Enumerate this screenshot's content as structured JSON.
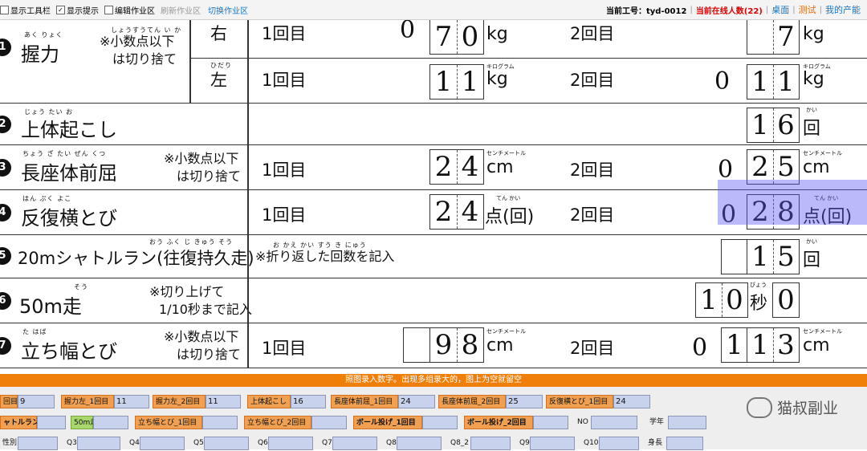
{
  "toolbar": {
    "cb_toolbar": "显示工具栏",
    "cb_hint": "显示提示",
    "cb_edit": "编辑作业区",
    "refresh": "刷新作业区",
    "switch": "切换作业区",
    "worker_label": "当前工号：tyd-0012",
    "online": "当前在线人数(22)",
    "desk": "桌面",
    "test": "测试",
    "yield": "我的产能"
  },
  "form": {
    "r1": {
      "num": "1",
      "title": "握力",
      "ruby": "あく りょく",
      "note1": "※小数点以下",
      "note2": "は切り捨て",
      "note_ruby": "しょうすうてん い か",
      "right": {
        "label": "右",
        "count1": "1回目",
        "d1a": "7",
        "d1b": "0",
        "unit": "kg",
        "count2": "2回目",
        "d2b": "7",
        "pre": "0"
      },
      "left": {
        "label": "左",
        "ruby": "ひだり",
        "count1": "1回目",
        "d1a": "1",
        "d1b": "1",
        "unit": "kg",
        "unit_ruby": "キログラム",
        "count2": "2回目",
        "pre": "0",
        "d2a": "1",
        "d2b": "1"
      }
    },
    "r2": {
      "num": "2",
      "title": "上体起こし",
      "ruby": "じょう たい お",
      "v1": "1",
      "v2": "6",
      "unit": "回",
      "unit_ruby": "かい"
    },
    "r3": {
      "num": "3",
      "title": "長座体前屈",
      "ruby": "ちょう ざ たい ぜん くつ",
      "note1": "※小数点以下",
      "note2": "は切り捨て",
      "count1": "1回目",
      "d1a": "2",
      "d1b": "4",
      "unit": "cm",
      "unit_ruby": "センチメートル",
      "count2": "2回目",
      "pre": "0",
      "d2a": "2",
      "d2b": "5"
    },
    "r4": {
      "num": "4",
      "title": "反復横とび",
      "ruby": "はん ぷく よこ",
      "count1": "1回目",
      "d1a": "2",
      "d1b": "4",
      "unit": "点(回)",
      "unit_ruby": "てん かい",
      "count2": "2回目",
      "pre": "0",
      "d2a": "2",
      "d2b": "8"
    },
    "r5": {
      "num": "5",
      "title": "20mシャトルラン(往復持久走)",
      "ruby": "おう ふく じ きゅう そう",
      "note": "※折り返した回数を記入",
      "note_ruby": "お かえ かい すう き にゅう",
      "v1": "1",
      "v2": "5",
      "unit": "回",
      "unit_ruby": "かい"
    },
    "r6": {
      "num": "6",
      "title": "50m走",
      "ruby": "そう",
      "note1": "※切り上げて",
      "note2": "1/10秒まで記入",
      "v1": "1",
      "v2": "0",
      "unit": "秒",
      "unit_ruby": "びょう",
      "v3": "0"
    },
    "r7": {
      "num": "7",
      "title": "立ち幅とび",
      "ruby": "た はば",
      "note1": "※小数点以下",
      "note2": "は切り捨て",
      "count1": "1回目",
      "d1a": "9",
      "d1b": "8",
      "unit": "cm",
      "unit_ruby": "センチメートル",
      "count2": "2回目",
      "pre": "0",
      "d2a": "1",
      "d2b": "1",
      "d2c": "3"
    }
  },
  "panel": {
    "banner": "照图录入数字。出现多组录大的，图上为空就留空",
    "row1": [
      {
        "label": "回目",
        "value": "9"
      },
      {
        "label": "握力左_1回目",
        "value": "11"
      },
      {
        "label": "握力左_2回目",
        "value": "11"
      },
      {
        "label": "上体起こし",
        "value": "16"
      },
      {
        "label": "長座体前屈_1回目",
        "value": "24"
      },
      {
        "label": "長座体前屈_2回目",
        "value": "25"
      },
      {
        "label": "反復横とび_1回目",
        "value": "24"
      }
    ],
    "row2": [
      {
        "label": "ャトルラン",
        "value": ""
      },
      {
        "label": "50m走",
        "value": ""
      },
      {
        "label": "立ち幅とび_1回目",
        "value": ""
      },
      {
        "label": "立ち幅とび_2回目",
        "value": ""
      },
      {
        "label": "ボール投げ_1回目",
        "value": ""
      },
      {
        "label": "ボール投げ_2回目",
        "value": ""
      },
      {
        "label": "NO",
        "value": ""
      },
      {
        "label": "学年",
        "value": ""
      }
    ],
    "row3": [
      {
        "label": "性別",
        "value": ""
      },
      {
        "label": "Q3",
        "value": ""
      },
      {
        "label": "Q4",
        "value": ""
      },
      {
        "label": "Q5",
        "value": ""
      },
      {
        "label": "Q6",
        "value": ""
      },
      {
        "label": "Q7",
        "value": ""
      },
      {
        "label": "Q8",
        "value": ""
      },
      {
        "label": "Q8_2",
        "value": ""
      },
      {
        "label": "Q9",
        "value": ""
      },
      {
        "label": "Q10",
        "value": ""
      },
      {
        "label": "身長",
        "value": ""
      }
    ]
  },
  "watermark": "猫叔副业"
}
